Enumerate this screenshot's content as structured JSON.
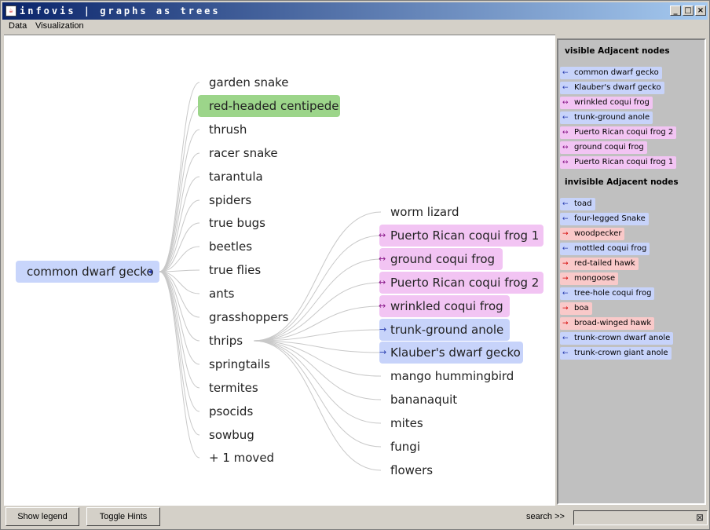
{
  "window": {
    "title": "infovis | graphs as trees"
  },
  "menu": {
    "items": [
      "Data",
      "Visualization"
    ]
  },
  "colors": {
    "visible_blue": "#c7d3fa",
    "visible_pink": "#f2c4f3",
    "root_blue": "#c8d5fb",
    "selected_green": "#9cd58a",
    "invisible_red": "#f9c9c9"
  },
  "graph": {
    "root": "common dwarf gecko",
    "level1": [
      "garden snake",
      "red-headed centipede",
      "thrush",
      "racer snake",
      "tarantula",
      "spiders",
      "true bugs",
      "beetles",
      "true flies",
      "ants",
      "grasshoppers",
      "thrips",
      "springtails",
      "termites",
      "psocids",
      "sowbug",
      "+ 1 moved"
    ],
    "level2": [
      "worm lizard",
      "Puerto Rican coqui frog 1",
      "ground coqui frog",
      "Puerto Rican coqui frog 2",
      "wrinkled coqui frog",
      "trunk-ground anole",
      "Klauber's dwarf gecko",
      "mango hummingbird",
      "bananaquit",
      "mites",
      "fungi",
      "flowers"
    ]
  },
  "side_panel": {
    "visible_header": "visible Adjacent nodes",
    "visible": [
      "common dwarf gecko",
      "Klauber's dwarf gecko",
      "wrinkled coqui frog",
      "trunk-ground anole",
      "Puerto Rican coqui frog 2",
      "ground coqui frog",
      "Puerto Rican coqui frog 1"
    ],
    "invisible_header": "invisible Adjacent nodes",
    "invisible": [
      "toad",
      "four-legged Snake",
      "woodpecker",
      "mottled coqui frog",
      "red-tailed hawk",
      "mongoose",
      "tree-hole coqui frog",
      "boa",
      "broad-winged hawk",
      "trunk-crown dwarf anole",
      "trunk-crown giant anole"
    ]
  },
  "bottom_bar": {
    "show_legend": "Show legend",
    "toggle_hints": "Toggle Hints",
    "search_label": "search >>",
    "search_value": ""
  },
  "icons": {
    "app": "java-cup-icon",
    "minimize": "minimize-icon",
    "maximize": "maximize-icon",
    "close": "close-icon",
    "clear": "clear-icon"
  }
}
